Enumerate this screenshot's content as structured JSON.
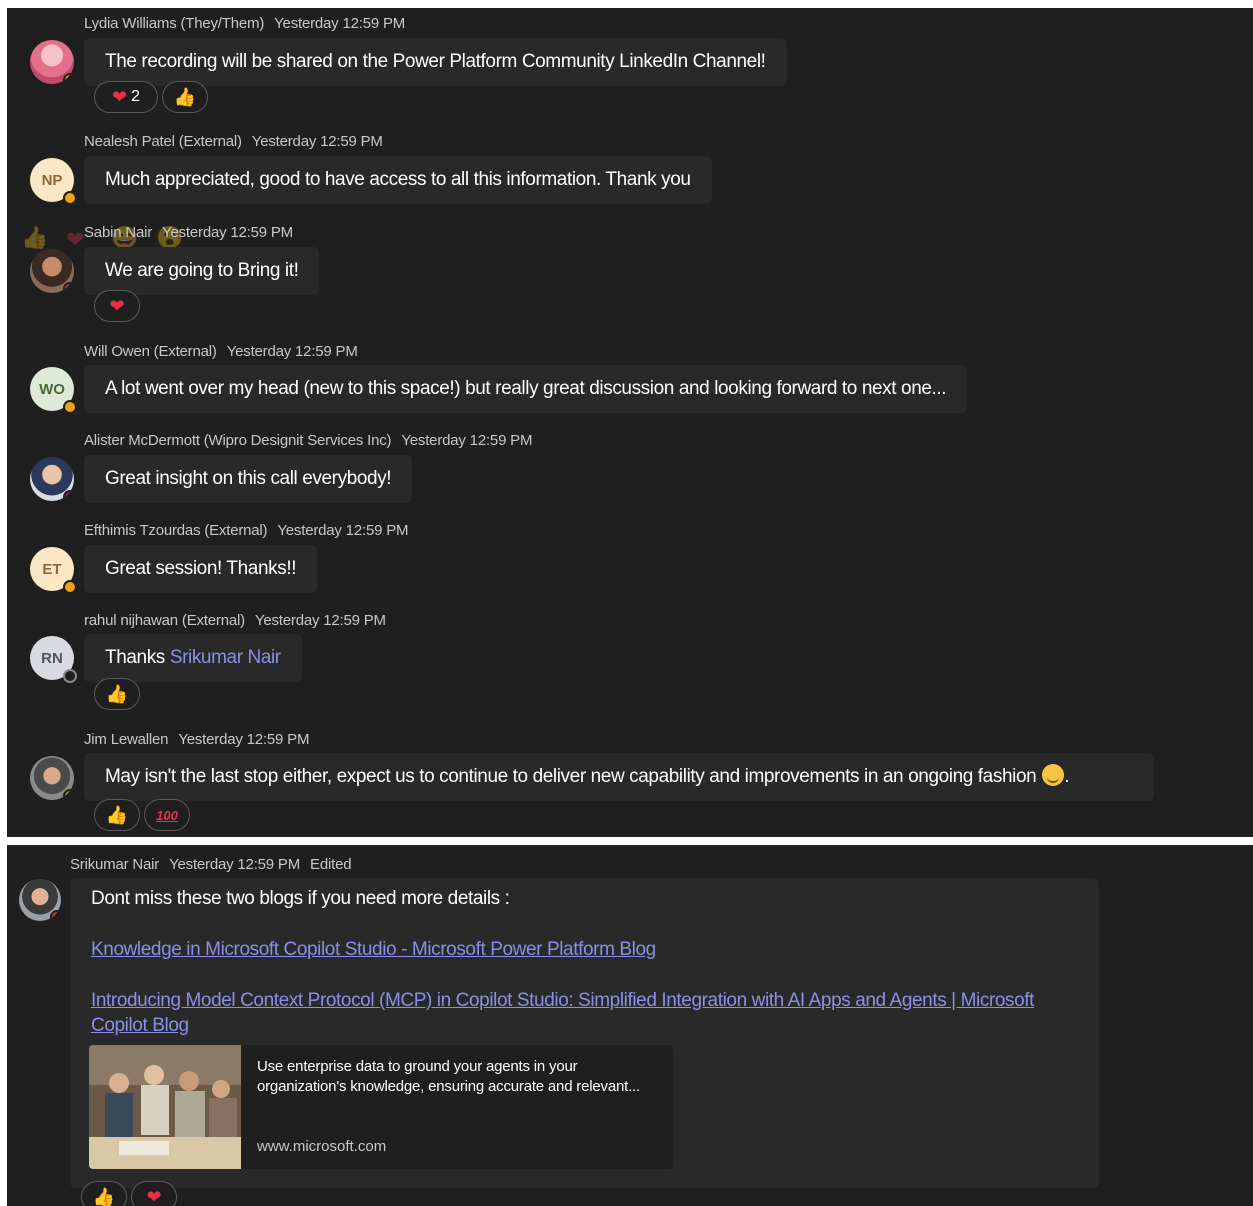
{
  "messages": [
    {
      "author": "Lydia Williams (They/Them)",
      "time": "Yesterday 12:59 PM",
      "text": "The recording will be shared on the Power Platform Community LinkedIn Channel!",
      "reactions": [
        {
          "emoji": "heart",
          "count": "2"
        },
        {
          "emoji": "thumbs-up",
          "count": ""
        }
      ]
    },
    {
      "author": "Nealesh Patel (External)",
      "time": "Yesterday 12:59 PM",
      "initials": "NP",
      "text": "Much appreciated, good to have access to all this information. Thank you"
    },
    {
      "author": "Sabin Nair",
      "time": "Yesterday 12:59 PM",
      "text": "We are going to Bring it!",
      "reactions": [
        {
          "emoji": "heart",
          "count": ""
        }
      ]
    },
    {
      "author": "Will Owen (External)",
      "time": "Yesterday 12:59 PM",
      "initials": "WO",
      "text": "A lot went over my head (new to this space!) but really great discussion and looking forward to next one..."
    },
    {
      "author": "Alister McDermott (Wipro Designit Services Inc)",
      "time": "Yesterday 12:59 PM",
      "text": "Great insight on this call everybody!"
    },
    {
      "author": "Efthimis Tzourdas (External)",
      "time": "Yesterday 12:59 PM",
      "initials": "ET",
      "text": "Great session! Thanks!!"
    },
    {
      "author": "rahul nijhawan (External)",
      "time": "Yesterday 12:59 PM",
      "initials": "RN",
      "text": "Thanks",
      "mention": "Srikumar Nair",
      "reactions": [
        {
          "emoji": "thumbs-up-light",
          "count": ""
        }
      ]
    },
    {
      "author": "Jim Lewallen",
      "time": "Yesterday 12:59 PM",
      "text": "May isn't the last stop either, expect us to continue to deliver new capability and improvements in an ongoing fashion",
      "text_end": ".",
      "reactions": [
        {
          "emoji": "thumbs-up",
          "count": ""
        },
        {
          "emoji": "hundred-points",
          "count": ""
        }
      ]
    }
  ],
  "emoji_glyphs": {
    "heart": "❤",
    "thumbs-up": "👍",
    "hundred-points": "100"
  },
  "final_message": {
    "author": "Srikumar Nair",
    "time": "Yesterday 12:59 PM",
    "edited": "Edited",
    "text": "Dont miss these two blogs if you need more details :",
    "link1": "Knowledge in Microsoft Copilot Studio - Microsoft Power Platform Blog",
    "link2_line1": "Introducing Model Context Protocol (MCP) in Copilot Studio: Simplified Integration with AI Apps and Agents | Microsoft",
    "link2_line2": "Copilot Blog",
    "preview": {
      "description": "Use enterprise data to ground your agents in your organization's knowledge, ensuring accurate and relevant...",
      "domain": "www.microsoft.com"
    },
    "reactions": [
      {
        "emoji": "thumbs-up"
      },
      {
        "emoji": "heart"
      }
    ]
  },
  "colors": {
    "background": "#1f1f1f",
    "bubble": "#292929",
    "link": "#8b8fe8",
    "heart": "#e8304a",
    "away": "#f0a30a",
    "busy": "#e0383e",
    "online": "#6bb700"
  }
}
